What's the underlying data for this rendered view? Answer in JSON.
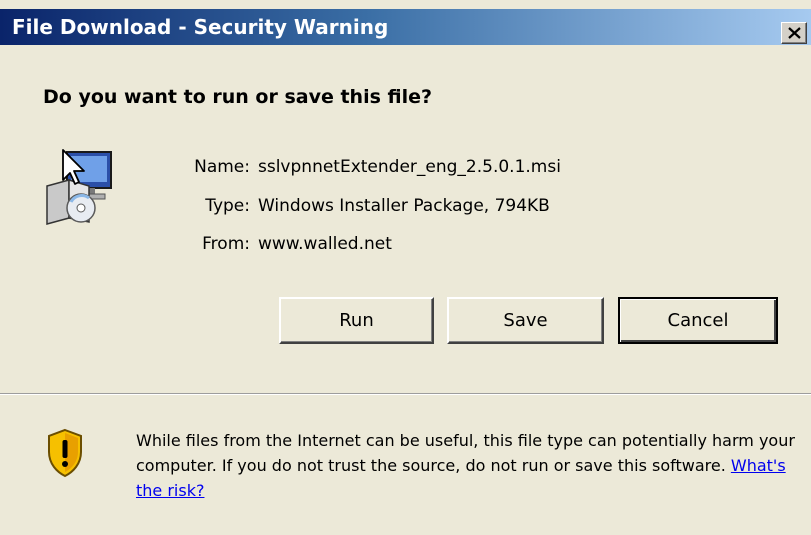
{
  "window": {
    "title": "File Download - Security Warning",
    "close_label": "X"
  },
  "dialog": {
    "question": "Do you want to run or save this file?",
    "file": {
      "name_label": "Name:",
      "name_value": "sslvpnnetExtender_eng_2.5.0.1.msi",
      "type_label": "Type:",
      "type_value": "Windows Installer Package, 794KB",
      "from_label": "From:",
      "from_value": "www.walled.net"
    },
    "buttons": {
      "run": "Run",
      "save": "Save",
      "cancel": "Cancel"
    },
    "warning": {
      "text": "While files from the Internet can be useful, this file type can potentially harm your computer. If you do not trust the source, do not run or save this software.",
      "link_text": "What's the risk?"
    }
  },
  "icons": {
    "app": "windows-installer-icon",
    "warning": "security-shield-icon",
    "close": "close-icon"
  },
  "colors": {
    "titlebar_start": "#0a246a",
    "titlebar_end": "#a6caf0",
    "dialog_bg": "#ece9d8",
    "link": "#0000ee",
    "shield_yellow": "#f6c000"
  }
}
